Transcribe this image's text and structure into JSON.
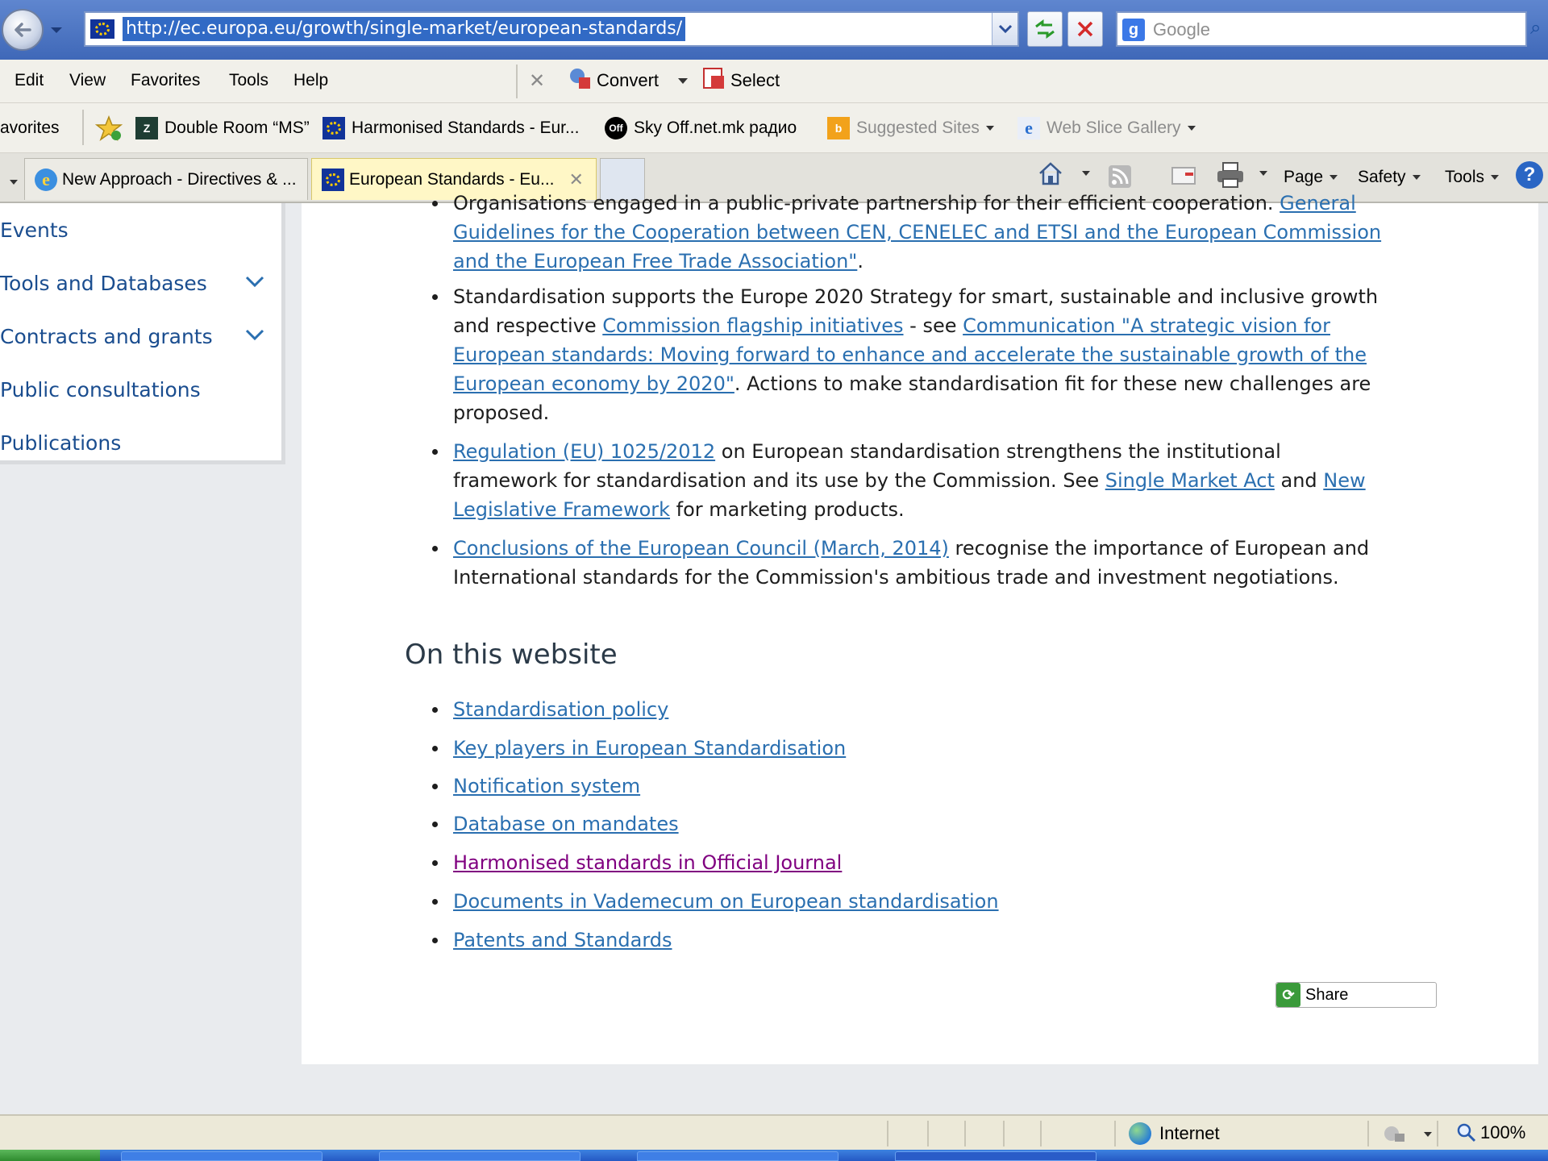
{
  "browser": {
    "address_url": "http://ec.europa.eu/growth/single-market/european-standards/",
    "search_placeholder": "Google",
    "menu": [
      "Edit",
      "View",
      "Favorites",
      "Tools",
      "Help"
    ],
    "toolbar": {
      "convert_label": "Convert",
      "select_label": "Select"
    },
    "favorites_label": "avorites",
    "favorites": [
      {
        "label": "Double Room “MS”",
        "icon": "z-icon"
      },
      {
        "label": "Harmonised Standards - Eur...",
        "icon": "eu-flag-icon"
      },
      {
        "label": "Sky  Off.net.mk радио",
        "icon": "off-icon"
      },
      {
        "label": "Suggested Sites",
        "icon": "bing-icon"
      },
      {
        "label": "Web Slice Gallery",
        "icon": "ie-icon"
      }
    ],
    "tabs": [
      {
        "label": "New Approach - Directives & ...",
        "active": false
      },
      {
        "label": "European Standards - Eu...",
        "active": true
      }
    ],
    "command_bar": {
      "page": "Page",
      "safety": "Safety",
      "tools": "Tools"
    },
    "status": {
      "zone": "Internet",
      "zoom": "100%"
    }
  },
  "sidebar": {
    "items": [
      {
        "label": "Events",
        "expandable": false
      },
      {
        "label": "Tools and Databases",
        "expandable": true
      },
      {
        "label": "Contracts and grants",
        "expandable": true
      },
      {
        "label": "Public consultations",
        "expandable": false
      },
      {
        "label": "Publications",
        "expandable": false
      }
    ]
  },
  "content": {
    "partial_top": {
      "cut_text": "Organisations engaged in a public-private partnership for their efficient cooperation. ",
      "cut_link": "General",
      "link_rest_1": "Guidelines for the Cooperation between CEN, CENELEC and ETSI and the European Commission",
      "link_rest_2": "and the European Free Trade Association\"",
      "tail": "."
    },
    "bullet_2": {
      "t1": "Standardisation supports the Europe 2020 Strategy for smart, sustainable and inclusive growth",
      "t2": "and respective ",
      "link1": "Commission flagship initiatives",
      "t3": " - see ",
      "link2a": "Communication \"A strategic vision for",
      "link2b": "European standards: Moving forward to enhance and accelerate the sustainable growth of the",
      "link2c": "European economy by 2020\"",
      "t4": ". Actions to make standardisation fit for these new challenges are",
      "t5": "proposed."
    },
    "bullet_3": {
      "link1": "Regulation (EU) 1025/2012",
      "t1": " on European standardisation strengthens the institutional",
      "t2": "framework for standardisation and its use by the Commission. See ",
      "link2": "Single Market Act",
      "t3": " and ",
      "link3a": "New",
      "link3b": "Legislative Framework",
      "t4": " for marketing products."
    },
    "bullet_4": {
      "link1": "Conclusions of the European Council (March, 2014)",
      "t1": " recognise the importance of European and",
      "t2": "International standards for the Commission's ambitious trade and investment negotiations."
    },
    "section_title": "On this website",
    "website_links": [
      {
        "label": "Standardisation policy",
        "visited": false
      },
      {
        "label": "Key players in European Standardisation",
        "visited": false
      },
      {
        "label": "Notification system",
        "visited": false
      },
      {
        "label": "Database on mandates",
        "visited": false
      },
      {
        "label": "Harmonised standards in Official Journal",
        "visited": true
      },
      {
        "label": "Documents in Vademecum on European standardisation",
        "visited": false
      },
      {
        "label": "Patents and Standards",
        "visited": false
      }
    ],
    "share_label": "Share"
  }
}
